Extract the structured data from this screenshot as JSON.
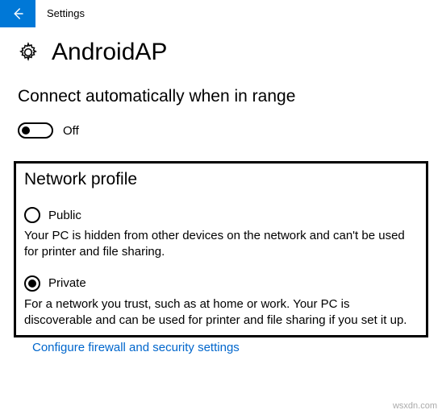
{
  "titlebar": {
    "back_icon": "←",
    "title": "Settings"
  },
  "network": {
    "icon_name": "gear-icon",
    "name": "AndroidAP"
  },
  "auto_connect": {
    "heading": "Connect automatically when in range",
    "toggle_state": "Off"
  },
  "profile": {
    "heading": "Network profile",
    "options": [
      {
        "label": "Public",
        "selected": false,
        "description": "Your PC is hidden from other devices on the network and can't be used for printer and file sharing."
      },
      {
        "label": "Private",
        "selected": true,
        "description": "For a network you trust, such as at home or work. Your PC is discoverable and can be used for printer and file sharing if you set it up."
      }
    ]
  },
  "link": {
    "text": "Configure firewall and security settings"
  },
  "watermark": "wsxdn.com"
}
